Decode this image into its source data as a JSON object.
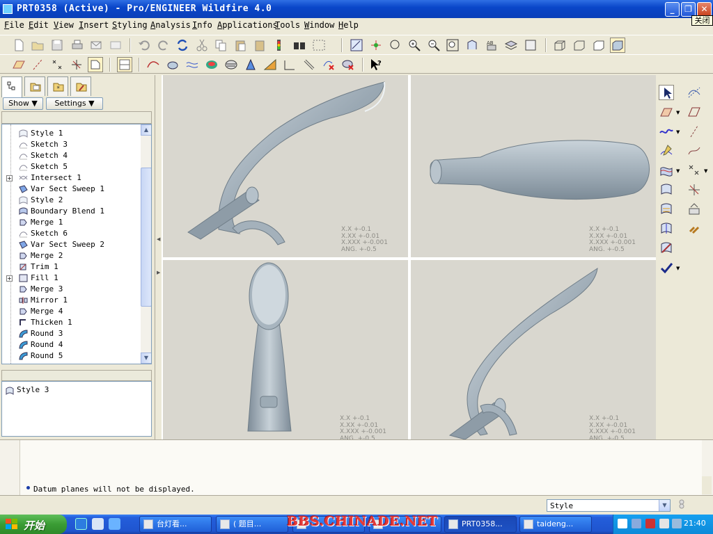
{
  "window": {
    "title": "PRT0358 (Active) - Pro/ENGINEER Wildfire 4.0",
    "minimize_glyph": "_",
    "maximize_glyph": "❐",
    "close_glyph": "✕",
    "close_tooltip": "关闭"
  },
  "menu": [
    "File",
    "Edit",
    "View",
    "Insert",
    "Styling",
    "Analysis",
    "Info",
    "Applications",
    "Tools",
    "Window",
    "Help"
  ],
  "navigator": {
    "show_label": "Show ▼",
    "settings_label": "Settings ▼",
    "tree_items": [
      {
        "label": "Style 1",
        "icon": "style-icon"
      },
      {
        "label": "Sketch 3",
        "icon": "sketch-icon"
      },
      {
        "label": "Sketch 4",
        "icon": "sketch-icon"
      },
      {
        "label": "Sketch 5",
        "icon": "sketch-icon"
      },
      {
        "label": "Intersect 1",
        "icon": "intersect-icon",
        "expandable": true
      },
      {
        "label": "Var Sect Sweep 1",
        "icon": "var-sect-sweep-icon"
      },
      {
        "label": "Style 2",
        "icon": "style-icon"
      },
      {
        "label": "Boundary Blend 1",
        "icon": "boundary-blend-icon"
      },
      {
        "label": "Merge 1",
        "icon": "merge-icon"
      },
      {
        "label": "Sketch 6",
        "icon": "sketch-icon"
      },
      {
        "label": "Var Sect Sweep 2",
        "icon": "var-sect-sweep-icon"
      },
      {
        "label": "Merge 2",
        "icon": "merge-icon"
      },
      {
        "label": "Trim 1",
        "icon": "trim-icon"
      },
      {
        "label": "Fill 1",
        "icon": "fill-icon",
        "expandable": true
      },
      {
        "label": "Merge 3",
        "icon": "merge-icon"
      },
      {
        "label": "Mirror 1",
        "icon": "mirror-icon"
      },
      {
        "label": "Merge 4",
        "icon": "merge-icon"
      },
      {
        "label": "Thicken 1",
        "icon": "thicken-icon"
      },
      {
        "label": "Round 3",
        "icon": "round-icon"
      },
      {
        "label": "Round 4",
        "icon": "round-icon"
      },
      {
        "label": "Round 5",
        "icon": "round-icon"
      }
    ],
    "selected_feature": "Style 3"
  },
  "viewports": {
    "tolerance": [
      "X.X +-0.1",
      "X.XX +-0.01",
      "X.XXX +-0.001",
      "ANG. +-0.5"
    ]
  },
  "messages": {
    "last": "Datum planes will not be displayed."
  },
  "status": {
    "filter_value": "Style",
    "filter_arrow": "▼"
  },
  "taskbar": {
    "start_label": "开始",
    "tasks": [
      "台灯看...",
      "( 题目...",
      "PRT0358...",
      "taideng..."
    ],
    "watermark": "BBS.CHINADE.NET",
    "clock": "21:40"
  },
  "colors": {
    "titlebar": "#0a46c9",
    "viewport_bg": "#d9d7cf",
    "model": "#a9b6c0",
    "accent_red": "#e33a3a"
  }
}
